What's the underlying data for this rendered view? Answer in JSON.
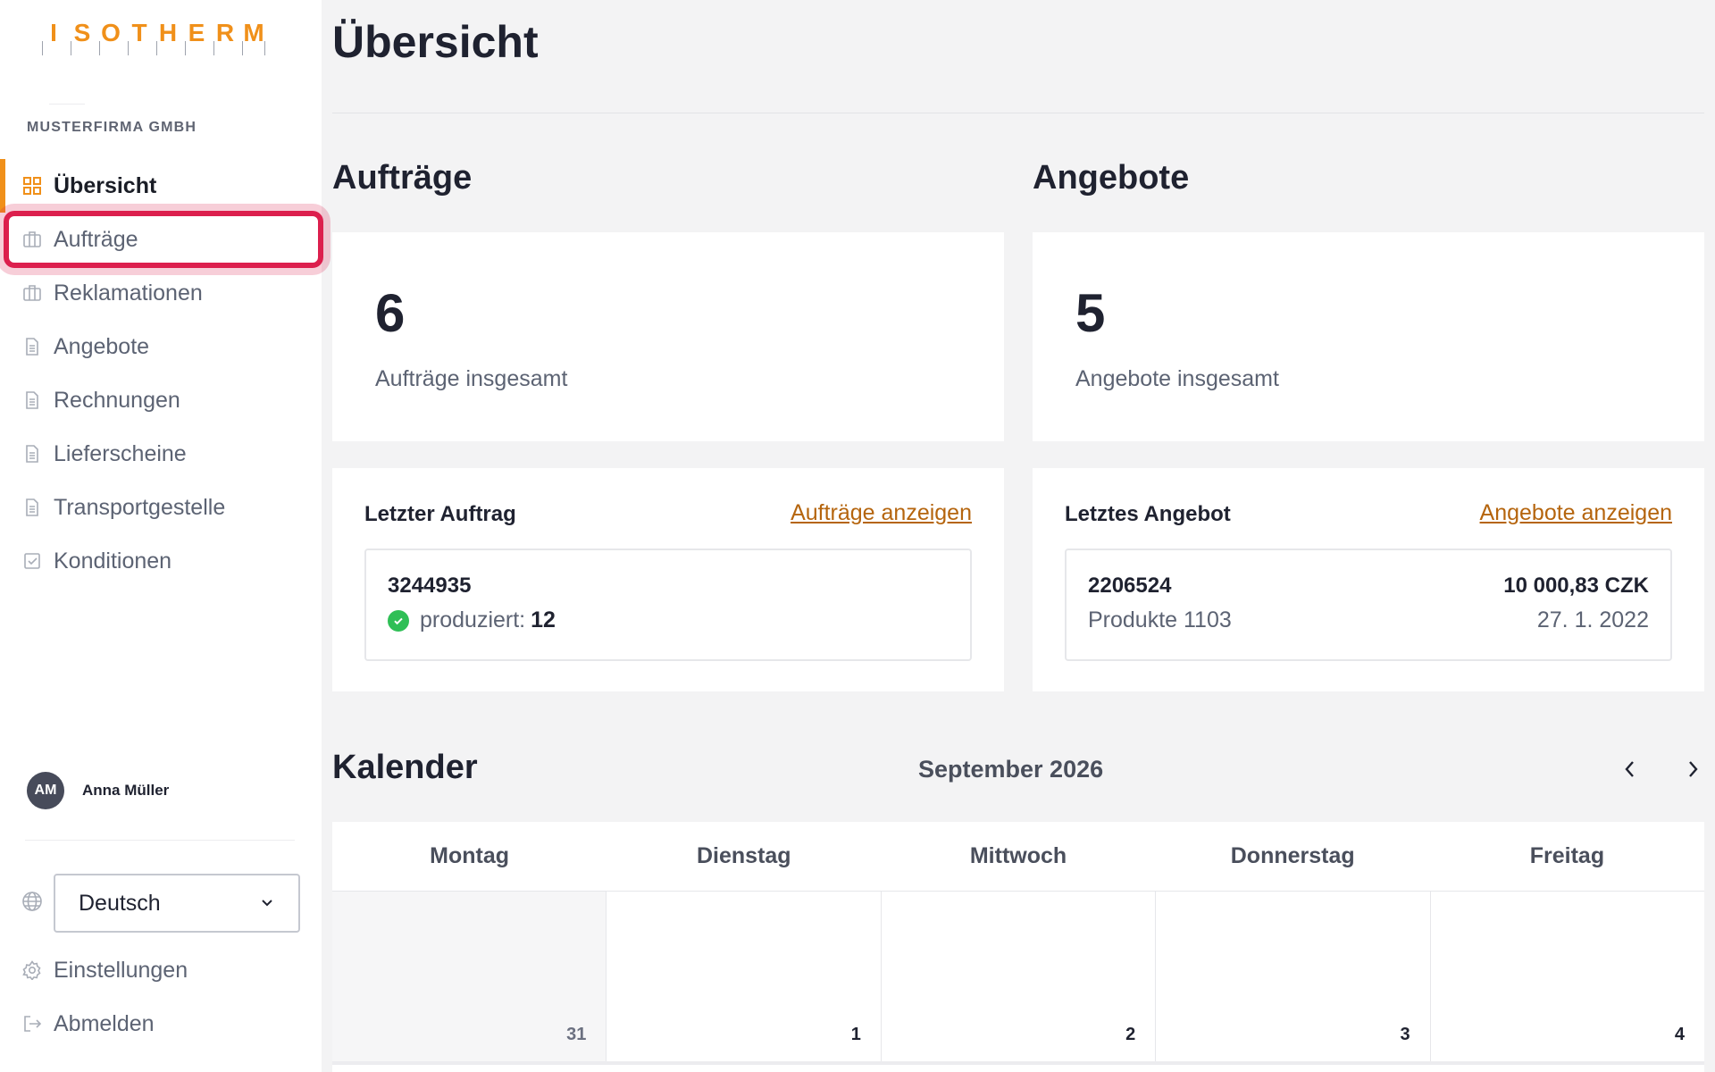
{
  "brand": {
    "logo_letters": [
      "I",
      "S",
      "O",
      "T",
      "H",
      "E",
      "R",
      "M"
    ],
    "accent": "#f0901a"
  },
  "company": "MUSTERFIRMA GMBH",
  "nav": [
    {
      "label": "Übersicht",
      "icon": "grid-icon",
      "active": true
    },
    {
      "label": "Aufträge",
      "icon": "briefcase-icon",
      "highlighted": true
    },
    {
      "label": "Reklamationen",
      "icon": "briefcase-icon"
    },
    {
      "label": "Angebote",
      "icon": "document-icon"
    },
    {
      "label": "Rechnungen",
      "icon": "document-icon"
    },
    {
      "label": "Lieferscheine",
      "icon": "document-icon"
    },
    {
      "label": "Transportgestelle",
      "icon": "document-icon"
    },
    {
      "label": "Konditionen",
      "icon": "checkbox-icon"
    }
  ],
  "user": {
    "initials": "AM",
    "name": "Anna Müller"
  },
  "language": {
    "selected": "Deutsch"
  },
  "footer_links": {
    "settings": "Einstellungen",
    "logout": "Abmelden"
  },
  "page": {
    "title": "Übersicht"
  },
  "orders": {
    "heading": "Aufträge",
    "total": "6",
    "total_label": "Aufträge insgesamt",
    "last_heading": "Letzter Auftrag",
    "view_link": "Aufträge anzeigen",
    "last": {
      "id": "3244935",
      "status_label": "produziert:",
      "status_value": "12"
    }
  },
  "offers": {
    "heading": "Angebote",
    "total": "5",
    "total_label": "Angebote insgesamt",
    "last_heading": "Letztes Angebot",
    "view_link": "Angebote anzeigen",
    "last": {
      "id": "2206524",
      "amount": "10 000,83 CZK",
      "product": "Produkte 1103",
      "date": "27. 1. 2022"
    }
  },
  "calendar": {
    "title": "Kalender",
    "month": "September 2026",
    "weekdays": [
      "Montag",
      "Dienstag",
      "Mittwoch",
      "Donnerstag",
      "Freitag"
    ],
    "days": [
      "31",
      "1",
      "2",
      "3",
      "4"
    ]
  },
  "colors": {
    "highlight": "#dc1f4d",
    "link": "#b5650e",
    "success": "#2fbf56"
  }
}
